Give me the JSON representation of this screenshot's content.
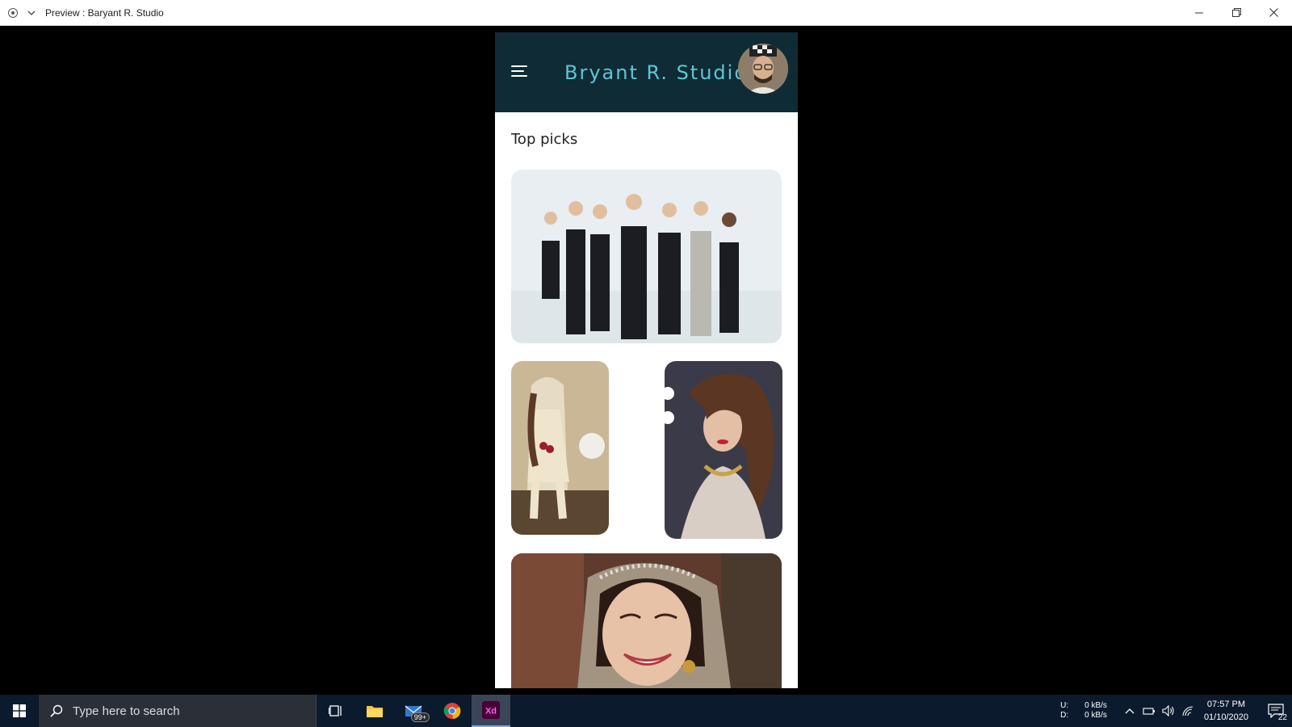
{
  "window": {
    "title": "Preview : Baryant R. Studio"
  },
  "app": {
    "brand": "Bryant R. Studio",
    "section_title": "Top picks",
    "header_bg": "#0f2b36",
    "brand_color": "#5fc6d3"
  },
  "cards": [
    {
      "name": "business-team-photo"
    },
    {
      "name": "bride-seated-photo"
    },
    {
      "name": "bride-portrait-photo"
    },
    {
      "name": "bride-smiling-photo"
    }
  ],
  "taskbar": {
    "search_placeholder": "Type here to search",
    "mail_badge": "99+",
    "net_up_label": "U:",
    "net_down_label": "D:",
    "net_up_value": "0 kB/s",
    "net_down_value": "0 kB/s",
    "time": "07:57 PM",
    "date": "01/10/2020",
    "notifications": "22"
  }
}
